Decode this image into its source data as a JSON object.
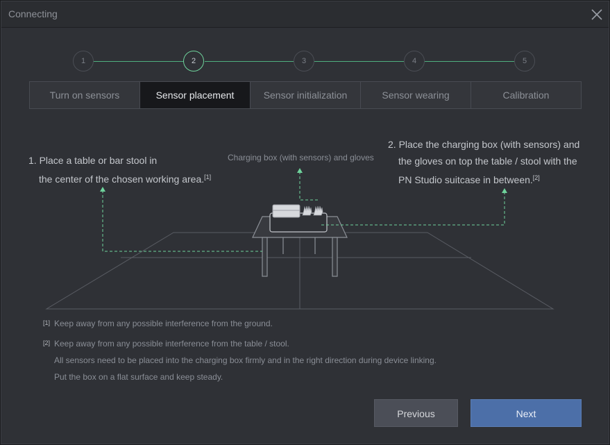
{
  "window": {
    "title": "Connecting"
  },
  "steps": [
    {
      "number": "1",
      "active": false
    },
    {
      "number": "2",
      "active": true
    },
    {
      "number": "3",
      "active": false
    },
    {
      "number": "4",
      "active": false
    },
    {
      "number": "5",
      "active": false
    }
  ],
  "tabs": [
    {
      "label": "Turn on sensors"
    },
    {
      "label": "Sensor placement",
      "active": true
    },
    {
      "label": "Sensor initialization"
    },
    {
      "label": "Sensor wearing"
    },
    {
      "label": "Calibration"
    }
  ],
  "instructions": {
    "step1_line1": "1. Place a table or bar stool in",
    "step1_line2": "the center of the chosen working area.",
    "step1_ref": "[1]",
    "step2_line1": "2. Place the charging box (with sensors) and",
    "step2_line2": "the gloves on top the table / stool with the",
    "step2_line3": "PN Studio suitcase in between.",
    "step2_ref": "[2]"
  },
  "illustration": {
    "caption": "Charging box (with sensors) and gloves"
  },
  "footnotes": {
    "fn1_mark": "[1]",
    "fn1_text": "Keep away from any possible interference from the ground.",
    "fn2_mark": "[2]",
    "fn2_text": "Keep away from any possible interference from the table / stool.",
    "fn2_line2": "All sensors need to be placed into the charging box firmly and in the right direction during device linking.",
    "fn2_line3": "Put the box on a flat surface and keep steady."
  },
  "buttons": {
    "previous": "Previous",
    "next": "Next"
  },
  "colors": {
    "accent": "#4c6fa8",
    "step_line": "#4fb07f",
    "dashed": "#6fd39c"
  }
}
